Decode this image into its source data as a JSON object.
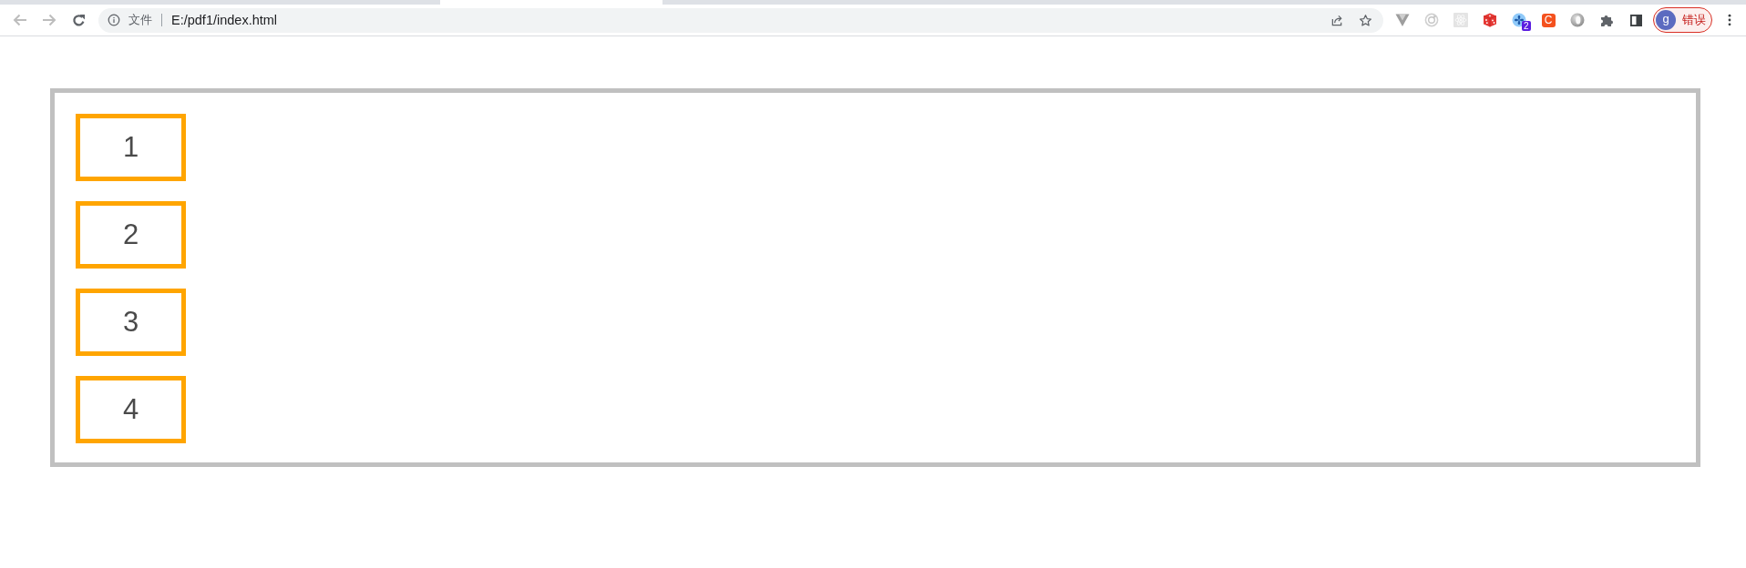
{
  "browser": {
    "back_button": {
      "disabled": true
    },
    "forward_button": {
      "disabled": true
    },
    "address_bar": {
      "security_label": "文件",
      "url": "E:/pdf1/index.html"
    },
    "extensions": {
      "badge_count": "2",
      "letter_tile": "C"
    },
    "profile": {
      "avatar_letter": "g",
      "status": "错误"
    }
  },
  "page": {
    "boxes": [
      {
        "label": "1"
      },
      {
        "label": "2"
      },
      {
        "label": "3"
      },
      {
        "label": "4"
      }
    ]
  }
}
